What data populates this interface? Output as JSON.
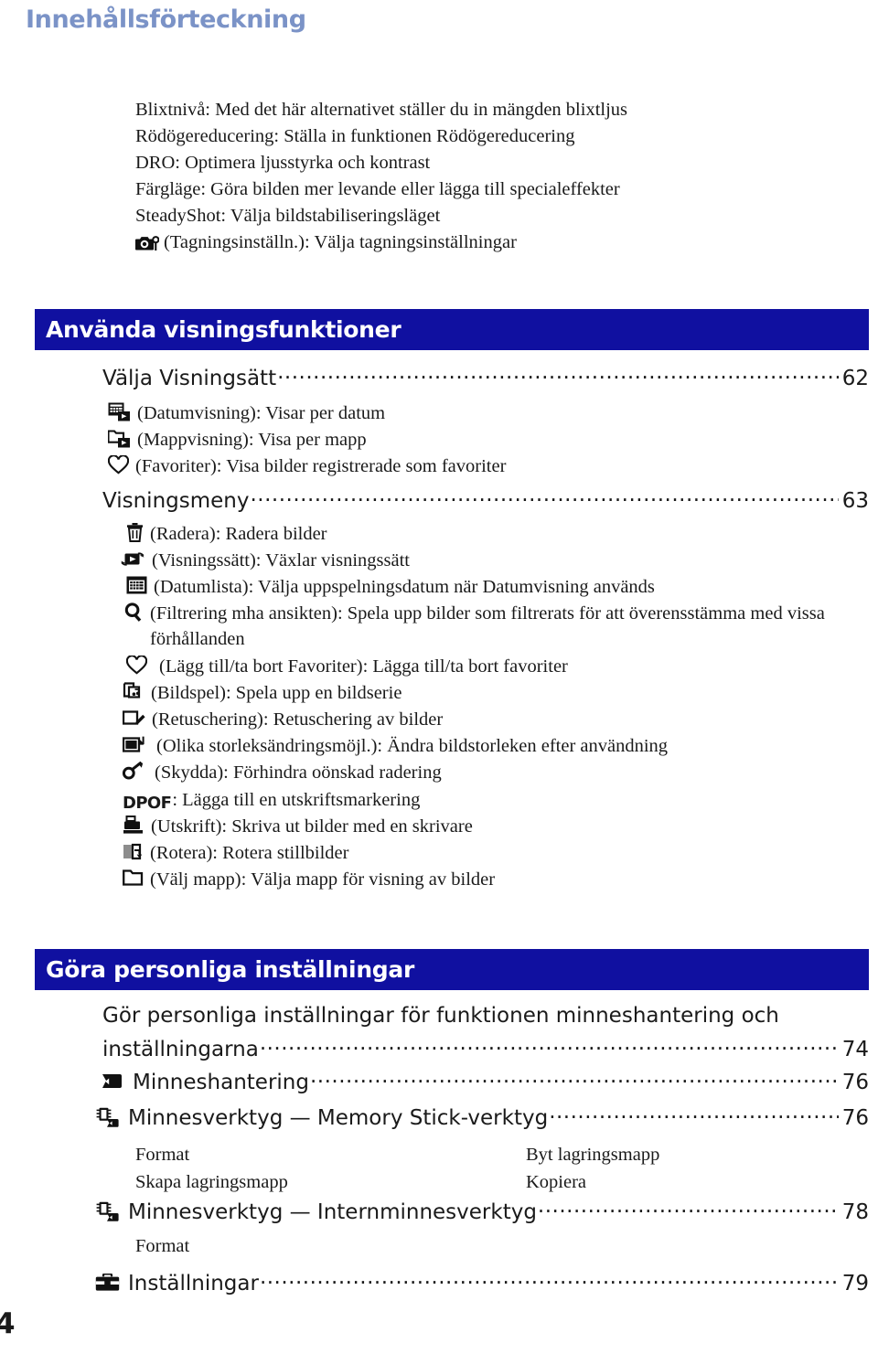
{
  "page": {
    "title": "Innehållsförteckning",
    "folio": "4",
    "title_color": "#7b93c7",
    "bar_color": "#1010a0",
    "bar_text_color": "#ffffff"
  },
  "intro_lines": [
    {
      "icon": null,
      "text": "Blixtnivå: Med det här alternativet ställer du in mängden blixtljus"
    },
    {
      "icon": null,
      "text": "Rödögereducering: Ställa in funktionen Rödögereducering"
    },
    {
      "icon": null,
      "text": "DRO: Optimera ljusstyrka och kontrast"
    },
    {
      "icon": null,
      "text": "Färgläge: Göra bilden mer levande eller lägga till specialeffekter"
    },
    {
      "icon": null,
      "text": "SteadyShot: Välja bildstabiliseringsläget"
    },
    {
      "icon": "camera-wrench-icon",
      "text": "(Tagningsinställn.): Välja tagningsinställningar"
    }
  ],
  "sections": [
    {
      "id": "playback",
      "bar_label": "Använda visningsfunktioner",
      "entries": [
        {
          "label": "Välja Visningsätt",
          "page": "62",
          "icon": null
        },
        {
          "label": "Visningsmeny",
          "page": "63",
          "icon": null
        }
      ]
    },
    {
      "id": "custom",
      "bar_label": "Göra personliga inställningar",
      "entries": [
        {
          "label_line1": "Gör personliga inställningar för funktionen minneshantering och",
          "label": "inställningarna",
          "page": "74",
          "icon": null
        },
        {
          "label": "Minneshantering",
          "page": "76",
          "icon": "memory-stick-icon"
        },
        {
          "label": "Minnesverktyg — Memory Stick-verktyg",
          "page": "76",
          "icon": "memory-tool-icon"
        },
        {
          "label": "Minnesverktyg — Internminnesverktyg",
          "page": "78",
          "icon": "memory-tool-icon"
        },
        {
          "label": "Inställningar",
          "page": "79",
          "icon": "toolbox-icon"
        }
      ]
    }
  ],
  "viewmode_items": [
    {
      "icon": "calendar-play-icon",
      "text": "(Datumvisning): Visar per datum"
    },
    {
      "icon": "folder-play-icon",
      "text": "(Mappvisning): Visa per mapp"
    },
    {
      "icon": "heart-icon",
      "text": "(Favoriter): Visa bilder registrerade som favoriter"
    }
  ],
  "viewmenu_items": [
    {
      "icon": "trash-icon",
      "text": "(Radera): Radera bilder"
    },
    {
      "icon": "playmode-switch-icon",
      "text": "(Visningssätt): Växlar visningssätt"
    },
    {
      "icon": "calendar-icon",
      "text": "(Datumlista): Välja uppspelningsdatum när Datumvisning används"
    },
    {
      "icon": "magnifier-icon",
      "text": "(Filtrering mha ansikten): Spela upp bilder som filtrerats för att överensstämma med vissa förhållanden"
    },
    {
      "icon": "heart-icon",
      "text": "(Lägg till/ta bort Favoriter): Lägga till/ta bort favoriter"
    },
    {
      "icon": "slideshow-icon",
      "text": "(Bildspel): Spela upp en bildserie"
    },
    {
      "icon": "retouch-icon",
      "text": "(Retuschering): Retuschering av bilder"
    },
    {
      "icon": "resize-icon",
      "text": "(Olika storleksändringsmöjl.): Ändra bildstorleken efter användning"
    },
    {
      "icon": "key-icon",
      "text": "(Skydda): Förhindra oönskad radering"
    },
    {
      "icon": "dpof-icon",
      "text": ": Lägga till en utskriftsmarkering"
    },
    {
      "icon": "printer-icon",
      "text": "(Utskrift): Skriva ut bilder med en skrivare"
    },
    {
      "icon": "rotate-icon",
      "text": "(Rotera): Rotera stillbilder"
    },
    {
      "icon": "folder-icon",
      "text": "(Välj mapp): Välja mapp för visning av bilder"
    }
  ],
  "memory_stick_tools": {
    "col1": [
      "Format",
      "Skapa lagringsmapp"
    ],
    "col2": [
      "Byt lagringsmapp",
      "Kopiera"
    ]
  },
  "internal_memory_tools": {
    "col1": [
      "Format"
    ],
    "col2": []
  },
  "dpof_glyph": "DPOF"
}
